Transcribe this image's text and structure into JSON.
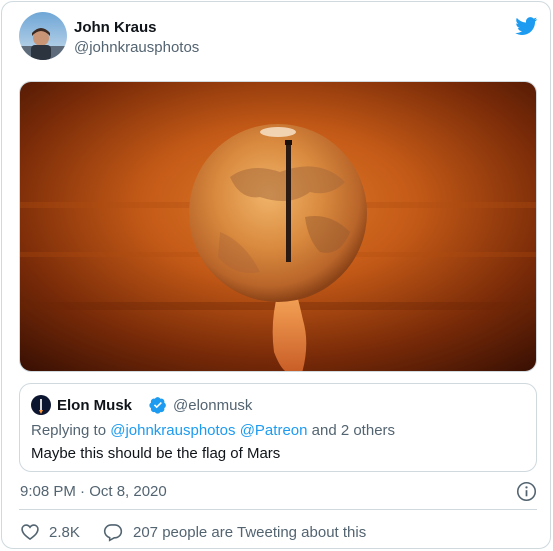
{
  "author": {
    "name": "John Kraus",
    "handle": "@johnkrausphotos"
  },
  "media": {
    "description_icon": "mars-launch-photo"
  },
  "quote": {
    "name": "Elon Musk",
    "handle": "@elonmusk",
    "replying_prefix": "Replying to ",
    "replying_to_1": "@johnkrausphotos",
    "replying_to_2": "@Patreon",
    "replying_suffix": " and 2 others",
    "text": "Maybe this should be the flag of Mars"
  },
  "meta": {
    "timestamp": "9:08 PM · Oct 8, 2020"
  },
  "actions": {
    "like_count": "2.8K",
    "reply_text": "207 people are Tweeting about this"
  },
  "colors": {
    "brand": "#1d9bf0",
    "text_primary": "#0f1419",
    "text_secondary": "#536471",
    "border": "#cfd9de"
  }
}
